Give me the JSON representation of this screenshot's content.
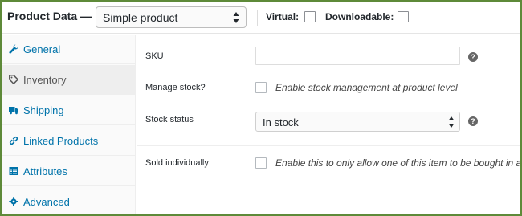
{
  "header": {
    "title": "Product Data —",
    "product_type": "Simple product",
    "virtual_label": "Virtual:",
    "downloadable_label": "Downloadable:"
  },
  "sidebar": {
    "items": [
      {
        "label": "General",
        "icon": "wrench-icon"
      },
      {
        "label": "Inventory",
        "icon": "tag-icon",
        "active": true
      },
      {
        "label": "Shipping",
        "icon": "truck-icon"
      },
      {
        "label": "Linked Products",
        "icon": "link-icon"
      },
      {
        "label": "Attributes",
        "icon": "list-icon"
      },
      {
        "label": "Advanced",
        "icon": "gear-icon"
      }
    ]
  },
  "panel": {
    "sku_label": "SKU",
    "sku_value": "",
    "manage_stock_label": "Manage stock?",
    "manage_stock_desc": "Enable stock management at product level",
    "stock_status_label": "Stock status",
    "stock_status_value": "In stock",
    "sold_individually_label": "Sold individually",
    "sold_individually_desc": "Enable this to only allow one of this item to be bought in a single order",
    "help_glyph": "?"
  },
  "colors": {
    "link": "#0073aa",
    "active_tab_text": "#555555",
    "frame_border": "#5e8a39"
  }
}
